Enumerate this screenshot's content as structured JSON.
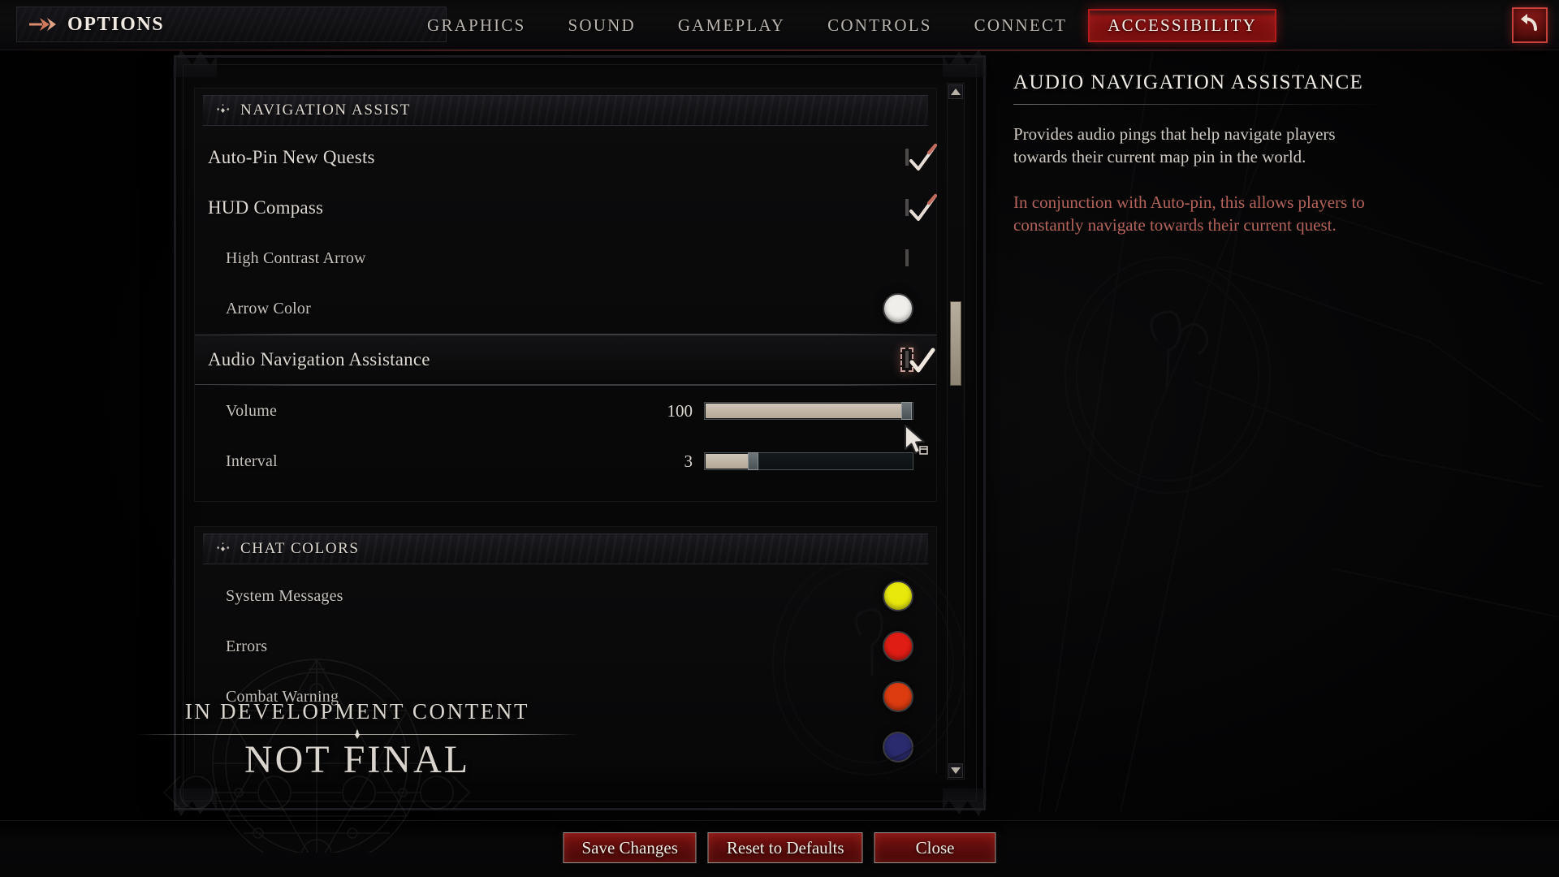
{
  "topbar": {
    "menu_label": "OPTIONS",
    "menu_icon": "double-arrow-icon",
    "back_icon": "back-arrow-icon",
    "tabs": [
      {
        "label": "GRAPHICS",
        "active": false
      },
      {
        "label": "SOUND",
        "active": false
      },
      {
        "label": "GAMEPLAY",
        "active": false
      },
      {
        "label": "CONTROLS",
        "active": false
      },
      {
        "label": "CONNECT",
        "active": false
      },
      {
        "label": "ACCESSIBILITY",
        "active": true
      }
    ],
    "active_tab": "ACCESSIBILITY",
    "active_tab_color": "#b01a18"
  },
  "settings": {
    "groups": [
      {
        "title": "NAVIGATION ASSIST",
        "icon": "diamond-cluster-icon",
        "rows": [
          {
            "label": "Auto-Pin New Quests",
            "type": "checkbox",
            "checked": true,
            "indent": false,
            "selected": false
          },
          {
            "label": "HUD Compass",
            "type": "checkbox",
            "checked": true,
            "indent": false,
            "selected": false
          },
          {
            "label": "High Contrast Arrow",
            "type": "checkbox",
            "checked": false,
            "indent": true,
            "selected": false
          },
          {
            "label": "Arrow Color",
            "type": "swatch",
            "color": "#f0eeea",
            "indent": true,
            "selected": false
          },
          {
            "label": "Audio Navigation Assistance",
            "type": "checkbox",
            "checked": true,
            "indent": false,
            "selected": true
          },
          {
            "label": "Volume",
            "type": "slider",
            "value": "100",
            "percent": 97,
            "indent": true,
            "selected": false
          },
          {
            "label": "Interval",
            "type": "slider",
            "value": "3",
            "percent": 23,
            "indent": true,
            "selected": false
          }
        ]
      },
      {
        "title": "CHAT COLORS",
        "icon": "diamond-cluster-icon",
        "rows": [
          {
            "label": "System Messages",
            "type": "swatch",
            "color": "#e8e80c",
            "indent": true,
            "selected": false
          },
          {
            "label": "Errors",
            "type": "swatch",
            "color": "#e01d14",
            "indent": true,
            "selected": false
          },
          {
            "label": "Combat Warning",
            "type": "swatch",
            "color": "#dc3c10",
            "indent": true,
            "selected": false
          },
          {
            "label": "",
            "type": "swatch",
            "color": "#2a2a6e",
            "indent": true,
            "selected": false
          }
        ]
      }
    ]
  },
  "scrollbar": {
    "up_icon": "chevron-up-icon",
    "down_icon": "chevron-down-icon"
  },
  "description": {
    "title": "AUDIO NAVIGATION ASSISTANCE",
    "body": "Provides audio pings that help navigate players towards their current map pin in the world.",
    "note": "In conjunction with Auto-pin, this allows players to constantly navigate towards their current quest.",
    "note_color": "#b4635a"
  },
  "watermark": {
    "line1": "IN DEVELOPMENT CONTENT",
    "line2": "NOT FINAL"
  },
  "footer": {
    "buttons": [
      {
        "label": "Save Changes"
      },
      {
        "label": "Reset to Defaults"
      },
      {
        "label": "Close"
      }
    ]
  },
  "cursor": {
    "icon": "mouse-pointer-icon"
  }
}
